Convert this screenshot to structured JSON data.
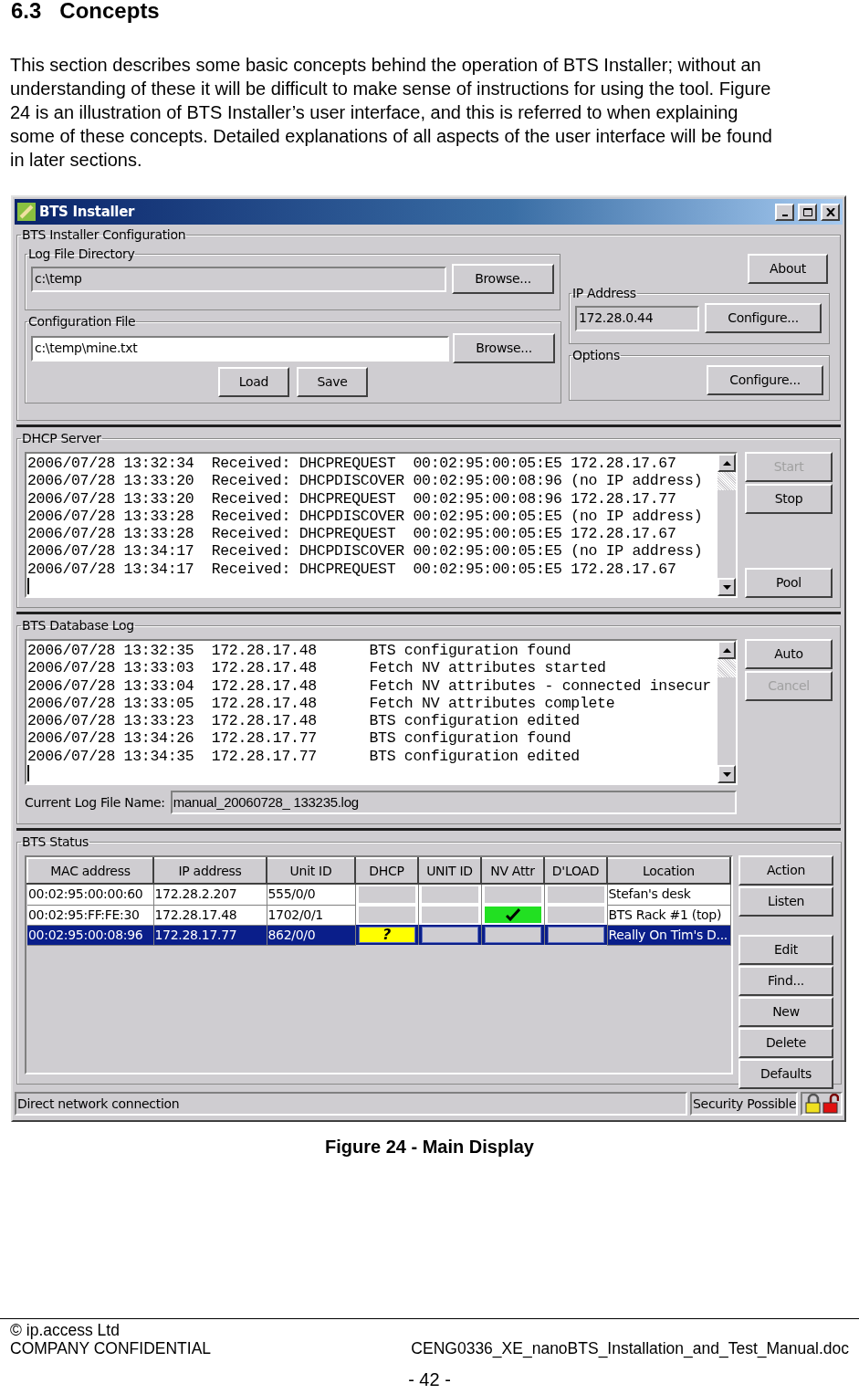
{
  "section": {
    "number": "6.3",
    "title": "Concepts"
  },
  "intro": "This section describes some basic concepts behind the operation of BTS Installer; without an understanding of these it will be difficult to make sense of instructions for using the tool. Figure 24 is an illustration of BTS Installer’s user interface, and this is referred to when explaining some of these concepts. Detailed explanations of all aspects of the user interface will be found in later sections.",
  "window": {
    "title": "BTS Installer",
    "config": {
      "title": "BTS Installer Configuration",
      "log_dir": {
        "title": "Log File Directory",
        "value": "c:\\temp",
        "read_only": true,
        "button": "Browse..."
      },
      "config_file": {
        "title": "Configuration File",
        "value": "c:\\temp\\mine.txt",
        "read_only": false,
        "button": "Browse..."
      },
      "buttons": [
        "Load",
        "Save"
      ],
      "about": "About",
      "ip": {
        "title": "IP Address",
        "value": "172.28.0.44",
        "read_only": true,
        "button": "Configure..."
      },
      "options": {
        "title": "Options",
        "button": "Configure..."
      }
    },
    "dhcp": {
      "title": "DHCP Server",
      "lines": [
        "2006/07/28 13:32:34  Received: DHCPREQUEST  00:02:95:00:05:E5 172.28.17.67",
        "2006/07/28 13:33:20  Received: DHCPDISCOVER 00:02:95:00:08:96 (no IP address)",
        "2006/07/28 13:33:20  Received: DHCPREQUEST  00:02:95:00:08:96 172.28.17.77",
        "2006/07/28 13:33:28  Received: DHCPDISCOVER 00:02:95:00:05:E5 (no IP address)",
        "2006/07/28 13:33:28  Received: DHCPREQUEST  00:02:95:00:05:E5 172.28.17.67",
        "2006/07/28 13:34:17  Received: DHCPDISCOVER 00:02:95:00:05:E5 (no IP address)",
        "2006/07/28 13:34:17  Received: DHCPREQUEST  00:02:95:00:05:E5 172.28.17.67"
      ],
      "buttons": [
        {
          "label": "Start",
          "disabled": true
        },
        {
          "label": "Stop",
          "disabled": false
        }
      ],
      "bottom_button": {
        "label": "Pool",
        "disabled": false
      }
    },
    "db_log": {
      "title": "BTS Database Log",
      "lines": [
        "2006/07/28 13:32:35  172.28.17.48      BTS configuration found",
        "2006/07/28 13:33:03  172.28.17.48      Fetch NV attributes started",
        "2006/07/28 13:33:04  172.28.17.48      Fetch NV attributes - connected insecur",
        "2006/07/28 13:33:05  172.28.17.48      Fetch NV attributes complete",
        "2006/07/28 13:33:23  172.28.17.48      BTS configuration edited",
        "2006/07/28 13:34:26  172.28.17.77      BTS configuration found",
        "2006/07/28 13:34:35  172.28.17.77      BTS configuration edited"
      ],
      "buttons": [
        {
          "label": "Auto",
          "disabled": false
        },
        {
          "label": "Cancel",
          "disabled": true
        }
      ],
      "file_label": "Current Log File Name:",
      "file_value": "manual_20060728_ 133235.log"
    },
    "status": {
      "title": "BTS Status",
      "columns": [
        "MAC address",
        "IP address",
        "Unit ID",
        "DHCP",
        "UNIT ID",
        "NV Attr",
        "D'LOAD",
        "Location"
      ],
      "rows": [
        {
          "selected": false,
          "mac": "00:02:95:00:00:60",
          "ip": "172.28.2.207",
          "unit": "555/0/0",
          "flags": [
            {
              "kind": "none"
            },
            {
              "kind": "none"
            },
            {
              "kind": "none"
            },
            {
              "kind": "none"
            }
          ],
          "location": "Stefan's desk"
        },
        {
          "selected": false,
          "mac": "00:02:95:FF:FE:30",
          "ip": "172.28.17.48",
          "unit": "1702/0/1",
          "flags": [
            {
              "kind": "none"
            },
            {
              "kind": "none"
            },
            {
              "kind": "ok"
            },
            {
              "kind": "none"
            }
          ],
          "location": "BTS Rack #1 (top)"
        },
        {
          "selected": true,
          "mac": "00:02:95:00:08:96",
          "ip": "172.28.17.77",
          "unit": "862/0/0",
          "flags": [
            {
              "kind": "unknown",
              "text": "?"
            },
            {
              "kind": "none"
            },
            {
              "kind": "none"
            },
            {
              "kind": "none"
            }
          ],
          "location": "Really On Tim's D..."
        }
      ],
      "top_buttons": [
        "Action",
        "Listen"
      ],
      "bottom_buttons": [
        "Edit",
        "Find...",
        "New",
        "Delete",
        "Defaults"
      ]
    },
    "status_bar": {
      "connection": "Direct network connection",
      "security": "Security Possible"
    }
  },
  "caption": "Figure 24 - Main Display",
  "footer": {
    "owner": "© ip.access Ltd",
    "classification": "COMPANY CONFIDENTIAL",
    "document": "CENG0336_XE_nanoBTS_Installation_and_Test_Manual.doc",
    "page": "- 42 -"
  }
}
